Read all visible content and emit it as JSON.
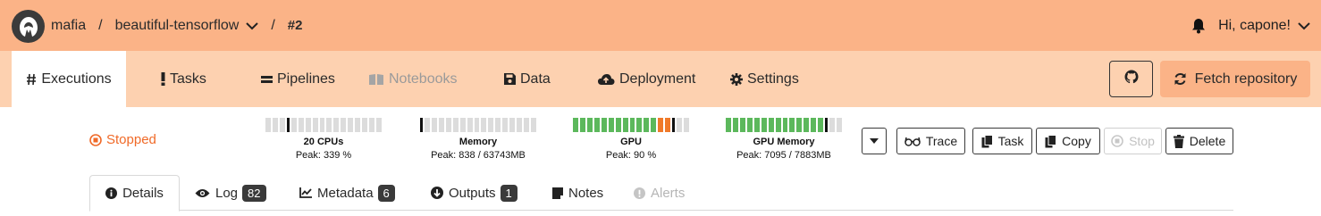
{
  "header": {
    "org": "mafia",
    "separator": "/",
    "repo": "beautiful-tensorflow",
    "execution_number": "#2",
    "greeting": "Hi, capone!"
  },
  "nav": {
    "tabs": [
      {
        "label": "Executions",
        "icon": "hash-icon",
        "state": "active"
      },
      {
        "label": "Tasks",
        "icon": "exclamation-icon",
        "state": "normal"
      },
      {
        "label": "Pipelines",
        "icon": "equals-icon",
        "state": "normal"
      },
      {
        "label": "Notebooks",
        "icon": "book-icon",
        "state": "disabled"
      },
      {
        "label": "Data",
        "icon": "floppy-icon",
        "state": "normal"
      },
      {
        "label": "Deployment",
        "icon": "cloud-upload-icon",
        "state": "normal"
      },
      {
        "label": "Settings",
        "icon": "gear-icon",
        "state": "normal"
      }
    ],
    "fetch_label": "Fetch repository"
  },
  "status": {
    "label": "Stopped",
    "color": "#f06a28"
  },
  "meters": [
    {
      "label": "20 CPUs",
      "peak": "Peak: 339 %",
      "fill_fraction": 0.17
    },
    {
      "label": "Memory",
      "peak": "Peak: 838 / 63743MB",
      "fill_fraction": 0.02
    },
    {
      "label": "GPU",
      "peak": "Peak: 90 %",
      "fill_fraction": 0.9
    },
    {
      "label": "GPU Memory",
      "peak": "Peak: 7095 / 7883MB",
      "fill_fraction": 0.9
    }
  ],
  "actions": {
    "trace": "Trace",
    "task": "Task",
    "copy": "Copy",
    "stop": "Stop",
    "delete": "Delete"
  },
  "detail_tabs": [
    {
      "label": "Details",
      "badge": null,
      "state": "active"
    },
    {
      "label": "Log",
      "badge": "82",
      "state": "normal"
    },
    {
      "label": "Metadata",
      "badge": "6",
      "state": "normal"
    },
    {
      "label": "Outputs",
      "badge": "1",
      "state": "normal"
    },
    {
      "label": "Notes",
      "badge": null,
      "state": "normal"
    },
    {
      "label": "Alerts",
      "badge": null,
      "state": "disabled"
    }
  ],
  "colors": {
    "header_bg": "#fbb387",
    "nav_bg": "#fdd1b0",
    "accent": "#f06a28",
    "gpu_green": "#5cb85c",
    "gpu_orange": "#f07a2a"
  }
}
